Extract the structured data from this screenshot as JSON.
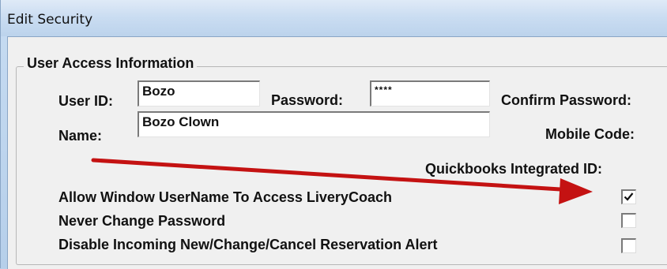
{
  "window": {
    "title": "Edit Security"
  },
  "group": {
    "legend": "User Access Information",
    "user_id_label": "User ID:",
    "user_id_value": "Bozo",
    "password_label": "Password:",
    "password_value": "****",
    "confirm_password_label": "Confirm Password:",
    "name_label": "Name:",
    "name_value": "Bozo Clown",
    "mobile_code_label": "Mobile Code:",
    "quickbooks_label": "Quickbooks Integrated ID:",
    "options": [
      {
        "label": "Allow Window UserName To Access LiveryCoach",
        "checked": true
      },
      {
        "label": "Never Change Password",
        "checked": false
      },
      {
        "label": "Disable Incoming New/Change/Cancel Reservation Alert",
        "checked": false
      }
    ]
  },
  "colors": {
    "arrow": "#c41212"
  }
}
